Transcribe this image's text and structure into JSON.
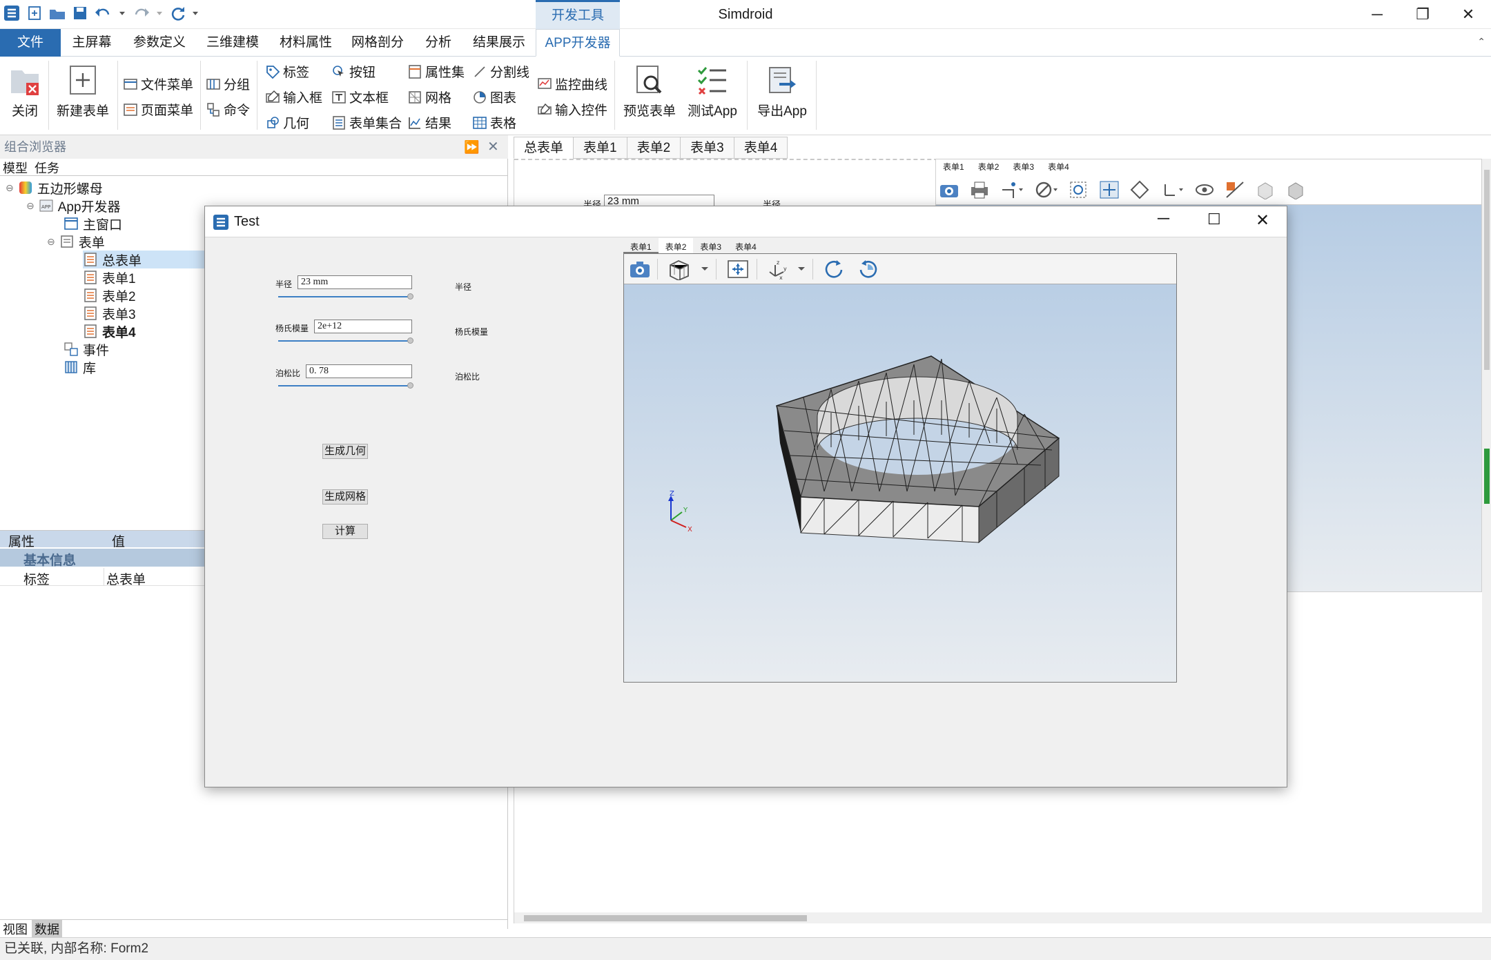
{
  "app": {
    "title": "Simdroid",
    "context_tab_group": "开发工具"
  },
  "menu_tabs": [
    "文件",
    "主屏幕",
    "参数定义",
    "三维建模",
    "材料属性",
    "网格剖分",
    "分析",
    "结果展示",
    "APP开发器"
  ],
  "ribbon": {
    "close": "关闭",
    "new_form": "新建表单",
    "file_menu": "文件菜单",
    "page_menu": "页面菜单",
    "group": "分组",
    "command": "命令",
    "label": "标签",
    "input_box": "输入框",
    "geometry": "几何",
    "button": "按钮",
    "text_box": "文本框",
    "form_set": "表单集合",
    "property_set": "属性集",
    "mesh": "网格",
    "result": "结果",
    "divider": "分割线",
    "chart": "图表",
    "table": "表格",
    "monitor_curve": "监控曲线",
    "input_control": "输入控件",
    "preview_form": "预览表单",
    "test_app": "测试App",
    "export_app": "导出App"
  },
  "left_panel": {
    "title": "组合浏览器",
    "tabs": [
      "模型",
      "任务"
    ],
    "tree": {
      "root": "五边形螺母",
      "app_dev": "App开发器",
      "main_window": "主窗口",
      "forms": "表单",
      "form_items": [
        "总表单",
        "表单1",
        "表单2",
        "表单3",
        "表单4"
      ],
      "events": "事件",
      "library": "库"
    },
    "props": {
      "col_property": "属性",
      "col_value": "值",
      "section": "基本信息",
      "key": "标签",
      "value": "总表单"
    },
    "bottom_tabs": [
      "视图",
      "数据"
    ]
  },
  "designer": {
    "tabs": [
      "总表单",
      "表单1",
      "表单2",
      "表单3",
      "表单4"
    ],
    "mini_tabs": [
      "表单1",
      "表单2",
      "表单3",
      "表单4"
    ],
    "bg_field_label": "半径",
    "bg_field_value": "23 mm",
    "bg_right_label": "半径"
  },
  "dialog": {
    "title": "Test",
    "fields": [
      {
        "label": "半径",
        "value": "23  mm",
        "side": "半径",
        "level": 1.0
      },
      {
        "label": "杨氏模量",
        "value": "2e+12",
        "side": "杨氏模量",
        "level": 1.0
      },
      {
        "label": "泊松比",
        "value": "0. 78",
        "side": "泊松比",
        "level": 1.0
      }
    ],
    "buttons": {
      "gen_geometry": "生成几何",
      "gen_mesh": "生成网格",
      "compute": "计算"
    },
    "viewer_tabs": [
      "表单1",
      "表单2",
      "表单3",
      "表单4"
    ],
    "axis_labels": {
      "x": "X",
      "y": "Y",
      "z": "Z"
    }
  },
  "status": "已关联, 内部名称: Form2",
  "colors": {
    "accent": "#2a6cb1",
    "panel_header": "#c9d8ea",
    "section_header": "#b5c9de"
  }
}
